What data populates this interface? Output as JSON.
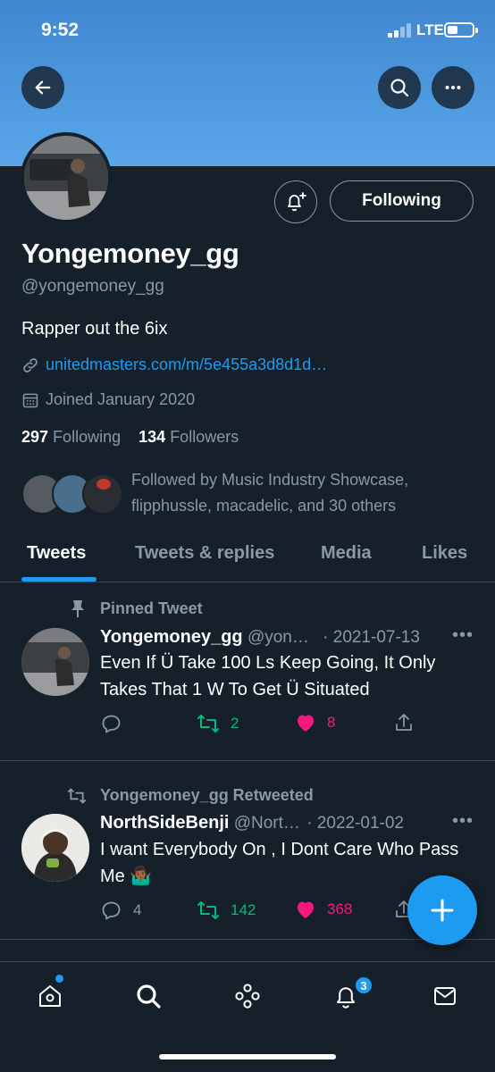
{
  "status_bar": {
    "time": "9:52",
    "network": "LTE"
  },
  "profile": {
    "display_name": "Yongemoney_gg",
    "handle": "@yongemoney_gg",
    "bio": "Rapper out the 6ix",
    "link": "unitedmasters.com/m/5e455a3d8d1d…",
    "joined": "Joined January 2020",
    "following_count": "297",
    "following_label": "Following",
    "followers_count": "134",
    "followers_label": "Followers",
    "followed_by": "Followed by Music Industry Showcase, flipphussle, macadelic, and 30 others",
    "follow_button": "Following"
  },
  "tabs": [
    {
      "label": "Tweets",
      "active": true
    },
    {
      "label": "Tweets & replies",
      "active": false
    },
    {
      "label": "Media",
      "active": false
    },
    {
      "label": "Likes",
      "active": false
    }
  ],
  "tweets": [
    {
      "context": "Pinned Tweet",
      "name": "Yongemoney_gg",
      "handle": "@yon…",
      "date": "· 2021-07-13",
      "text": "Even If Ü Take 100 Ls Keep Going, It Only Takes That 1 W To Get Ü Situated",
      "replies": "",
      "retweets": "2",
      "likes": "8"
    },
    {
      "context": "Yongemoney_gg Retweeted",
      "name": "NorthSideBenji",
      "handle": "@Nort…",
      "date": "· 2022-01-02",
      "text": "I want Everybody On , I Dont Care Who Pass Me 🤷🏾‍♂️",
      "replies": "4",
      "retweets": "142",
      "likes": "368"
    }
  ],
  "nav": {
    "notifications_badge": "3"
  },
  "colors": {
    "background": "#15202b",
    "accent": "#1d9bf0",
    "retweet": "#00ba7c",
    "like": "#f91880",
    "muted": "#8b98a5"
  }
}
